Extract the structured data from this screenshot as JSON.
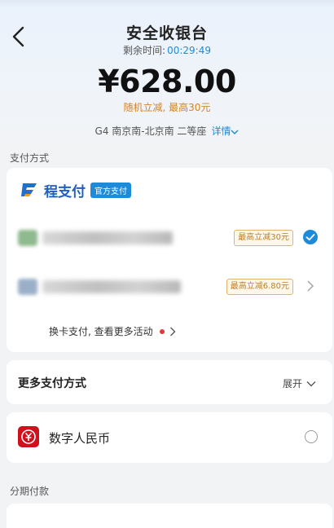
{
  "header": {
    "title": "安全收银台",
    "timer_label": "剩余时间:",
    "timer_value": "00:29:49"
  },
  "amount": "¥628.00",
  "discount_text": "随机立减, 最高30元",
  "trip": {
    "text": "G4 南京南-北京南 二等座",
    "detail_label": "详情"
  },
  "payment_section_label": "支付方式",
  "brand": {
    "name": "程支付",
    "tag": "官方支付"
  },
  "pay_rows": [
    {
      "promo": "最高立减30元",
      "selected": true
    },
    {
      "promo": "最高立减6.80元",
      "selected": false
    }
  ],
  "switch_card_text": "换卡支付, 查看更多活动",
  "more_methods": {
    "label": "更多支付方式",
    "expand_label": "展开"
  },
  "digital_rmb": {
    "label": "数字人民币"
  },
  "installment_label": "分期付款",
  "colors": {
    "accent_blue": "#1e8bd8",
    "promo_orange": "#d4822a",
    "rmb_red": "#d0111b"
  },
  "icons": [
    "back-arrow-icon",
    "chevron-down-icon",
    "check-circle-icon",
    "chevron-right-icon",
    "digital-rmb-icon",
    "brand-logo-icon"
  ]
}
